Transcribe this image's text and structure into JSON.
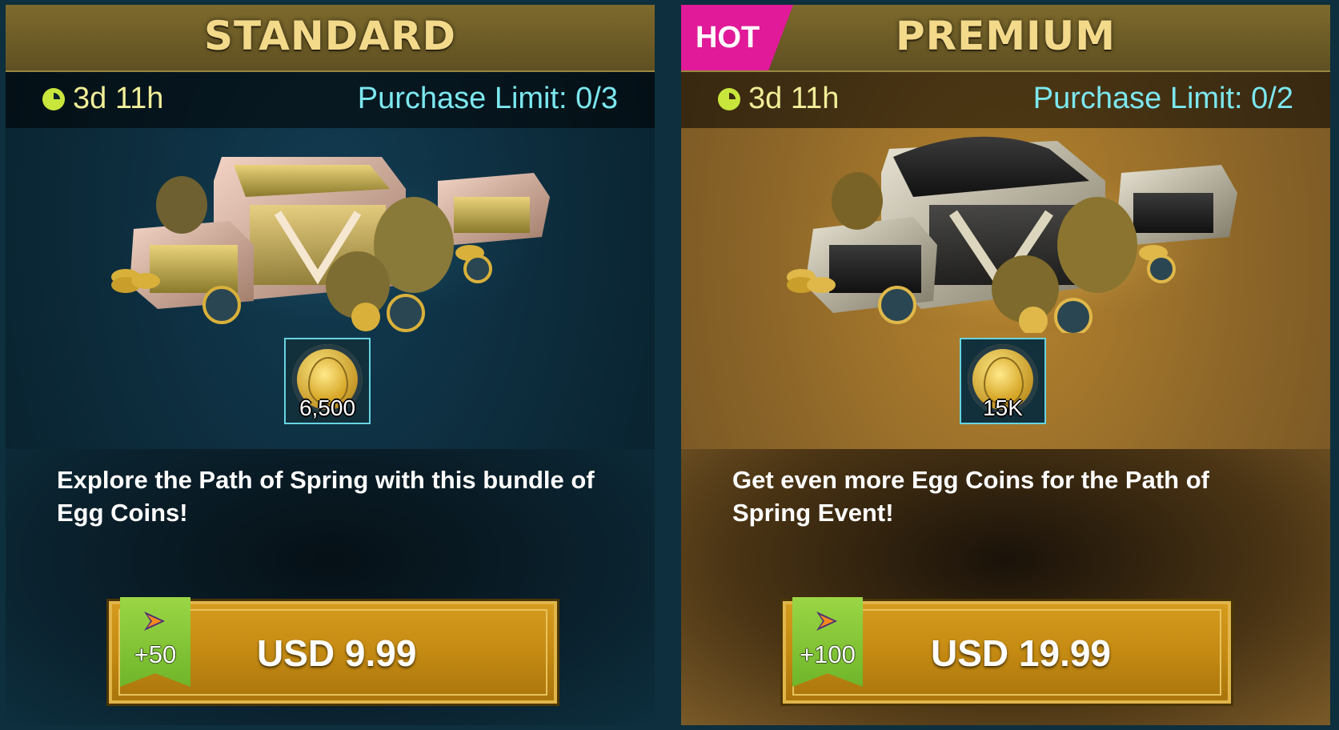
{
  "offers": [
    {
      "title": "STANDARD",
      "timer": "3d 11h",
      "purchase_limit": "Purchase Limit: 0/3",
      "reward_amount": "6,500",
      "description": "Explore the Path of Spring with this bundle of Egg Coins!",
      "bonus": "+50",
      "price": "USD 9.99"
    },
    {
      "badge": "HOT",
      "title": "PREMIUM",
      "timer": "3d 11h",
      "purchase_limit": "Purchase Limit: 0/2",
      "reward_amount": "15K",
      "description": "Get even more Egg Coins for the Path of Spring Event!",
      "bonus": "+100",
      "price": "USD 19.99"
    }
  ],
  "colors": {
    "header_gold": "#7d6a2c",
    "hot_pink": "#e01a98",
    "limit_cyan": "#7ce7ef",
    "timer_yellow": "#c8e63c",
    "button_gold": "#c48a12",
    "bonus_green": "#6fb52a"
  },
  "icons": {
    "timer": "clock-icon",
    "reward": "egg-coin-icon",
    "bonus": "vip-arrow-icon"
  }
}
